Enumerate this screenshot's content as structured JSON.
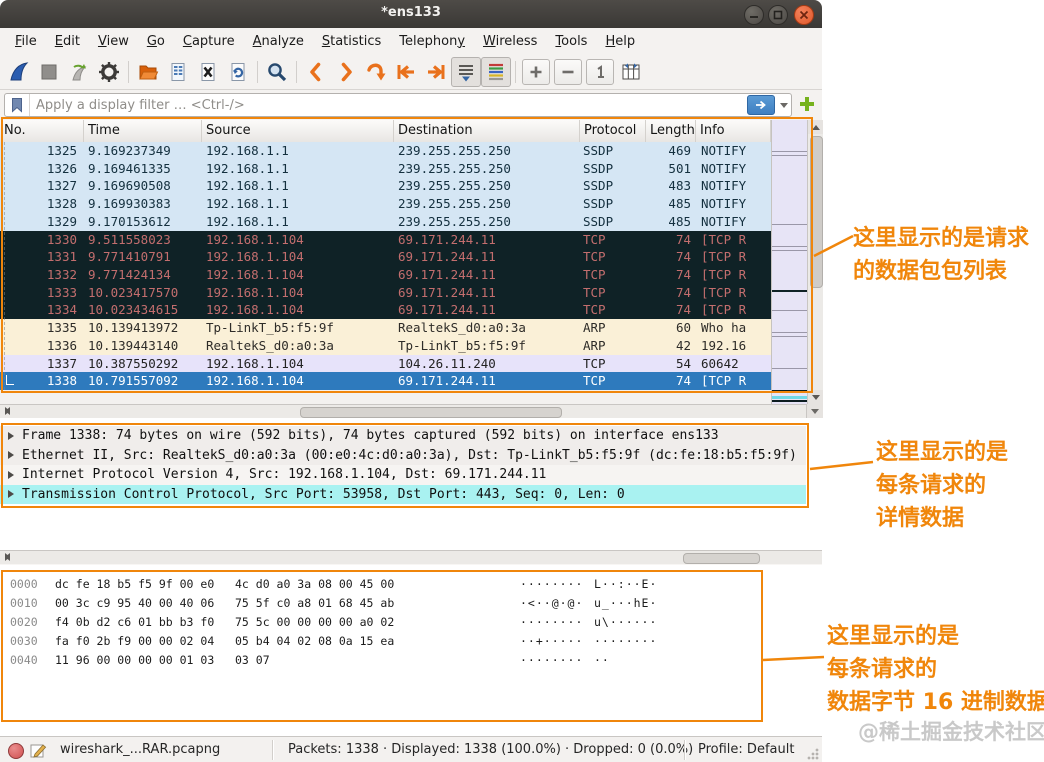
{
  "window": {
    "title": "*ens133"
  },
  "menu": {
    "items": [
      {
        "pre": "",
        "mn": "F",
        "post": "ile"
      },
      {
        "pre": "",
        "mn": "E",
        "post": "dit"
      },
      {
        "pre": "",
        "mn": "V",
        "post": "iew"
      },
      {
        "pre": "",
        "mn": "G",
        "post": "o"
      },
      {
        "pre": "",
        "mn": "C",
        "post": "apture"
      },
      {
        "pre": "",
        "mn": "A",
        "post": "nalyze"
      },
      {
        "pre": "",
        "mn": "S",
        "post": "tatistics"
      },
      {
        "pre": "Telephon",
        "mn": "y",
        "post": ""
      },
      {
        "pre": "",
        "mn": "W",
        "post": "ireless"
      },
      {
        "pre": "",
        "mn": "T",
        "post": "ools"
      },
      {
        "pre": "",
        "mn": "H",
        "post": "elp"
      }
    ]
  },
  "toolbar": {
    "buttons": [
      "start-capture",
      "stop-capture",
      "restart-capture",
      "capture-options",
      "open-file",
      "save-file",
      "close-file",
      "reload-file",
      "find-packet",
      "go-back",
      "go-forward",
      "go-to-packet",
      "go-first-packet",
      "go-last-packet",
      "auto-scroll",
      "colorize-packets",
      "zoom-in",
      "zoom-out",
      "zoom-100",
      "resize-columns"
    ]
  },
  "filter": {
    "placeholder": "Apply a display filter … <Ctrl-/>"
  },
  "packet_list": {
    "columns": [
      "No.",
      "Time",
      "Source",
      "Destination",
      "Protocol",
      "Length",
      "Info"
    ],
    "rows": [
      {
        "no": "1325",
        "time": "9.169237349",
        "src": "192.168.1.1",
        "dst": "239.255.255.250",
        "proto": "SSDP",
        "len": "469",
        "info": "NOTIFY",
        "style": "ssdp"
      },
      {
        "no": "1326",
        "time": "9.169461335",
        "src": "192.168.1.1",
        "dst": "239.255.255.250",
        "proto": "SSDP",
        "len": "501",
        "info": "NOTIFY",
        "style": "ssdp"
      },
      {
        "no": "1327",
        "time": "9.169690508",
        "src": "192.168.1.1",
        "dst": "239.255.255.250",
        "proto": "SSDP",
        "len": "483",
        "info": "NOTIFY",
        "style": "ssdp"
      },
      {
        "no": "1328",
        "time": "9.169930383",
        "src": "192.168.1.1",
        "dst": "239.255.255.250",
        "proto": "SSDP",
        "len": "485",
        "info": "NOTIFY",
        "style": "ssdp"
      },
      {
        "no": "1329",
        "time": "9.170153612",
        "src": "192.168.1.1",
        "dst": "239.255.255.250",
        "proto": "SSDP",
        "len": "485",
        "info": "NOTIFY",
        "style": "ssdp"
      },
      {
        "no": "1330",
        "time": "9.511558023",
        "src": "192.168.1.104",
        "dst": "69.171.244.11",
        "proto": "TCP",
        "len": "74",
        "info": "[TCP R",
        "style": "tcprst"
      },
      {
        "no": "1331",
        "time": "9.771410791",
        "src": "192.168.1.104",
        "dst": "69.171.244.11",
        "proto": "TCP",
        "len": "74",
        "info": "[TCP R",
        "style": "tcprst"
      },
      {
        "no": "1332",
        "time": "9.771424134",
        "src": "192.168.1.104",
        "dst": "69.171.244.11",
        "proto": "TCP",
        "len": "74",
        "info": "[TCP R",
        "style": "tcprst"
      },
      {
        "no": "1333",
        "time": "10.023417570",
        "src": "192.168.1.104",
        "dst": "69.171.244.11",
        "proto": "TCP",
        "len": "74",
        "info": "[TCP R",
        "style": "tcprst"
      },
      {
        "no": "1334",
        "time": "10.023434615",
        "src": "192.168.1.104",
        "dst": "69.171.244.11",
        "proto": "TCP",
        "len": "74",
        "info": "[TCP R",
        "style": "tcprst"
      },
      {
        "no": "1335",
        "time": "10.139413972",
        "src": "Tp-LinkT_b5:f5:9f",
        "dst": "RealtekS_d0:a0:3a",
        "proto": "ARP",
        "len": "60",
        "info": "Who ha",
        "style": "arp"
      },
      {
        "no": "1336",
        "time": "10.139443140",
        "src": "RealtekS_d0:a0:3a",
        "dst": "Tp-LinkT_b5:f5:9f",
        "proto": "ARP",
        "len": "42",
        "info": "192.16",
        "style": "arp"
      },
      {
        "no": "1337",
        "time": "10.387550292",
        "src": "192.168.1.104",
        "dst": "104.26.11.240",
        "proto": "TCP",
        "len": "54",
        "info": "60642",
        "style": "tcp"
      },
      {
        "no": "1338",
        "time": "10.791557092",
        "src": "192.168.1.104",
        "dst": "69.171.244.11",
        "proto": "TCP",
        "len": "74",
        "info": "[TCP R",
        "style": "selected"
      }
    ]
  },
  "details": {
    "rows": [
      {
        "text": "Frame 1338: 74 bytes on wire (592 bits), 74 bytes captured (592 bits) on interface ens133",
        "style": "gray"
      },
      {
        "text": "Ethernet II, Src: RealtekS_d0:a0:3a (00:e0:4c:d0:a0:3a), Dst: Tp-LinkT_b5:f5:9f (dc:fe:18:b5:f5:9f)",
        "style": "gray"
      },
      {
        "text": "Internet Protocol Version 4, Src: 192.168.1.104, Dst: 69.171.244.11",
        "style": "light"
      },
      {
        "text": "Transmission Control Protocol, Src Port: 53958, Dst Port: 443, Seq: 0, Len: 0",
        "style": "cyan"
      }
    ]
  },
  "hex": {
    "rows": [
      {
        "offset": "0000",
        "hex1": "dc fe 18 b5 f5 9f 00 e0",
        "hex2": "4c d0 a0 3a 08 00 45 00",
        "ascii1": "········",
        "ascii2": "L··:··E·"
      },
      {
        "offset": "0010",
        "hex1": "00 3c c9 95 40 00 40 06",
        "hex2": "75 5f c0 a8 01 68 45 ab",
        "ascii1": "·<··@·@·",
        "ascii2": "u_···hE·"
      },
      {
        "offset": "0020",
        "hex1": "f4 0b d2 c6 01 bb b3 f0",
        "hex2": "75 5c 00 00 00 00 a0 02",
        "ascii1": "········",
        "ascii2": "u\\······"
      },
      {
        "offset": "0030",
        "hex1": "fa f0 2b f9 00 00 02 04",
        "hex2": "05 b4 04 02 08 0a 15 ea",
        "ascii1": "··+·····",
        "ascii2": "········"
      },
      {
        "offset": "0040",
        "hex1": "11 96 00 00 00 00 01 03",
        "hex2": "03 07",
        "ascii1": "········",
        "ascii2": "··"
      }
    ]
  },
  "status": {
    "filename": "wireshark_...RAR.pcapng",
    "packets": "Packets: 1338 · Displayed: 1338 (100.0%) · Dropped: 0 (0.0%)",
    "profile": "Profile: Default"
  },
  "annotations": {
    "a1": [
      "这里显示的是请求",
      "的数据包包列表"
    ],
    "a2": [
      "这里显示的是",
      "每条请求的",
      "详情数据"
    ],
    "a3": [
      "这里显示的是",
      "每条请求的",
      "数据字节 16 进制数据"
    ],
    "watermark": "@稀土掘金技术社区"
  },
  "colors": {
    "annotation_orange": "#f0860b",
    "selected_row": "#2e7abd",
    "ssdp_row_bg": "#d5e6f4",
    "tcp_rst_row_bg": "#0f2226",
    "tcp_rst_row_text": "#c36e6e",
    "arp_row_bg": "#faf0d7",
    "tcp_row_bg": "#e7e3fa",
    "details_highlight": "#a9f2f1",
    "close_button": "#e0582b"
  }
}
